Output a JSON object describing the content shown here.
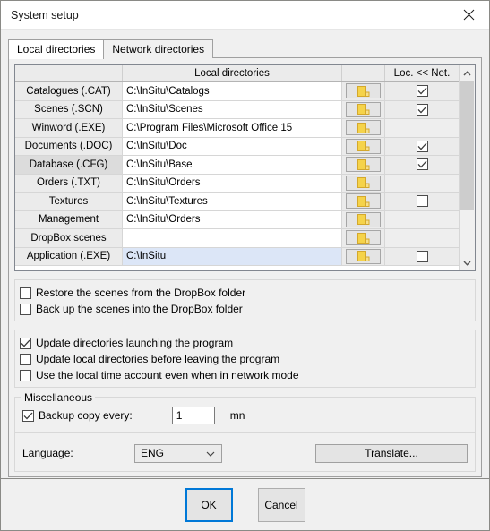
{
  "window": {
    "title": "System setup",
    "close_icon": "close-icon"
  },
  "tabs": [
    {
      "label": "Local directories",
      "active": true
    },
    {
      "label": "Network directories",
      "active": false
    }
  ],
  "grid": {
    "headers": {
      "name": "",
      "path": "Local directories",
      "browse": "",
      "sync": "Loc. << Net."
    },
    "rows": [
      {
        "name": "Catalogues (.CAT)",
        "path": "C:\\InSitu\\Catalogs",
        "browse_icon": "folder-icon",
        "checkbox": "checked",
        "selected": false,
        "hover": false
      },
      {
        "name": "Scenes (.SCN)",
        "path": "C:\\InSitu\\Scenes",
        "browse_icon": "folder-icon",
        "checkbox": "checked",
        "selected": false,
        "hover": false
      },
      {
        "name": "Winword (.EXE)",
        "path": "C:\\Program Files\\Microsoft Office 15",
        "browse_icon": "folder-icon",
        "checkbox": "none",
        "selected": false,
        "hover": false
      },
      {
        "name": "Documents (.DOC)",
        "path": "C:\\InSitu\\Doc",
        "browse_icon": "folder-icon",
        "checkbox": "checked",
        "selected": false,
        "hover": false
      },
      {
        "name": "Database (.CFG)",
        "path": "C:\\InSitu\\Base",
        "browse_icon": "folder-icon",
        "checkbox": "checked",
        "selected": false,
        "hover": true
      },
      {
        "name": "Orders (.TXT)",
        "path": "C:\\InSitu\\Orders",
        "browse_icon": "folder-icon",
        "checkbox": "none",
        "selected": false,
        "hover": false
      },
      {
        "name": "Textures",
        "path": "C:\\InSitu\\Textures",
        "browse_icon": "folder-icon",
        "checkbox": "unchecked",
        "selected": false,
        "hover": false
      },
      {
        "name": "Management",
        "path": "C:\\InSitu\\Orders",
        "browse_icon": "folder-icon",
        "checkbox": "none",
        "selected": false,
        "hover": false
      },
      {
        "name": "DropBox scenes",
        "path": "",
        "browse_icon": "folder-icon",
        "checkbox": "none",
        "selected": false,
        "hover": false
      },
      {
        "name": "Application (.EXE)",
        "path": "C:\\InSitu",
        "browse_icon": "folder-icon",
        "checkbox": "unchecked",
        "selected": true,
        "hover": false
      }
    ],
    "scrollbar": {
      "up_icon": "chevron-up-icon",
      "down_icon": "chevron-down-icon"
    }
  },
  "dropbox_options": [
    {
      "label": "Restore the scenes from the DropBox folder",
      "checked": false
    },
    {
      "label": "Back up the scenes into the DropBox folder",
      "checked": false
    }
  ],
  "program_options": [
    {
      "label": "Update directories launching the program",
      "checked": true
    },
    {
      "label": "Update local directories before leaving the program",
      "checked": false
    },
    {
      "label": "Use the local time account even when in network mode",
      "checked": false
    }
  ],
  "miscellaneous": {
    "title": "Miscellaneous",
    "backup": {
      "label": "Backup copy every:",
      "checked": true,
      "value": "1",
      "unit": "mn"
    },
    "language": {
      "label": "Language:",
      "value": "ENG",
      "caret_icon": "chevron-down-icon"
    },
    "translate_label": "Translate..."
  },
  "footer": {
    "ok_label": "OK",
    "cancel_label": "Cancel"
  },
  "colors": {
    "accent": "#0078d7",
    "selection": "#dce6f7",
    "folder": "#f5d34a"
  }
}
